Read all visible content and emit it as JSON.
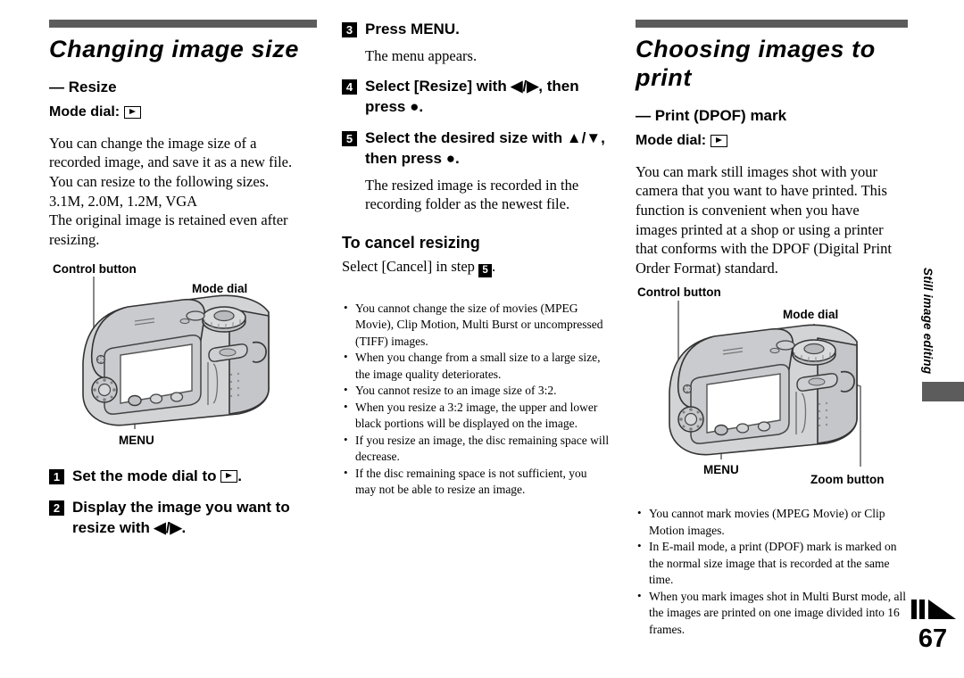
{
  "page": {
    "number": "67",
    "side_tab": "Still image editing",
    "rule_color": "#5c5c5c",
    "ff_icon": "fast-forward-icon"
  },
  "left_column": {
    "chapter_title": "Changing image size",
    "sub_heading": "— Resize",
    "mode_dial_label": "Mode dial:",
    "mode_dial_icon": "playback-mode-icon",
    "intro": [
      "You can change the image size of a",
      "recorded image, and save it as a new file.",
      "You can resize to the following sizes.",
      "3.1M, 2.0M, 1.2M, VGA",
      "The original image is retained even after",
      "resizing."
    ],
    "figure": {
      "name": "camera-rear-illustration",
      "labels": {
        "control_button": "Control button",
        "mode_dial": "Mode dial",
        "menu": "MENU"
      }
    },
    "steps": [
      {
        "num": "1",
        "text": "Set the mode dial to ",
        "icon": "playback-mode-icon",
        "tail": "."
      },
      {
        "num": "2",
        "text": "Display the image you want to resize with ◀/▶."
      }
    ]
  },
  "middle_column": {
    "steps": [
      {
        "num": "3",
        "text": "Press MENU.",
        "note": "The menu appears."
      },
      {
        "num": "4",
        "text": "Select [Resize] with ◀/▶, then press ●.",
        "note": ""
      },
      {
        "num": "5",
        "text": "Select the desired size with ▲/▼, then press ●.",
        "note": "The resized image is recorded in the recording folder as the newest file."
      }
    ],
    "cancel_heading": "To cancel resizing",
    "cancel_text_before": "Select [Cancel] in step ",
    "cancel_step_num": "5",
    "cancel_text_after": ".",
    "notes": [
      "You cannot change the size of movies (MPEG Movie), Clip Motion, Multi Burst or uncompressed (TIFF) images.",
      "When you change from a small size to a large size, the image quality deteriorates.",
      "You cannot resize to an image size of 3:2.",
      "When you resize a 3:2 image, the upper and lower black portions will be displayed on the image.",
      "If you resize an image, the disc remaining space will decrease.",
      "If the disc remaining space is not sufficient, you may not be able to resize an image."
    ]
  },
  "right_column": {
    "chapter_title": "Choosing images to print",
    "sub_heading": "— Print (DPOF) mark",
    "mode_dial_label": "Mode dial:",
    "mode_dial_icon": "playback-mode-icon",
    "intro": [
      "You can mark still images shot with your",
      "camera that you want to have printed. This",
      "function is convenient when you have",
      "images printed at a shop or using a printer",
      "that conforms with the DPOF (Digital Print",
      "Order Format) standard."
    ],
    "figure": {
      "name": "camera-rear-illustration",
      "labels": {
        "control_button": "Control button",
        "mode_dial": "Mode dial",
        "menu": "MENU",
        "zoom_button": "Zoom button"
      }
    },
    "notes": [
      "You cannot mark movies (MPEG Movie) or Clip Motion images.",
      "In E-mail mode, a print (DPOF) mark is marked on the normal size image that is recorded at the same time.",
      "When you mark images shot in Multi Burst mode, all the images are printed on one image divided into 16 frames."
    ]
  }
}
